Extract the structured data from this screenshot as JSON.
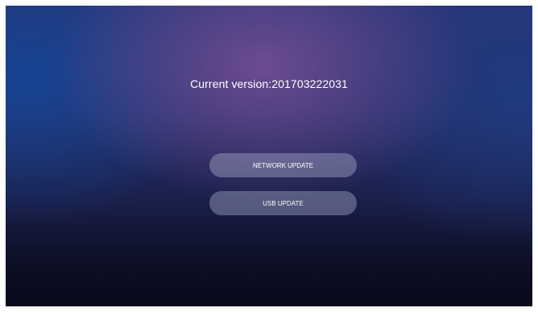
{
  "screen": {
    "version_text": "Current version:201703222031"
  },
  "buttons": {
    "network_update": "NETWORK UPDATE",
    "usb_update": "USB UPDATE"
  },
  "colors": {
    "text": "#ffffff",
    "button_bg": "#b9bed7",
    "bg_top": "#2a3577",
    "bg_bottom": "#08091a"
  }
}
